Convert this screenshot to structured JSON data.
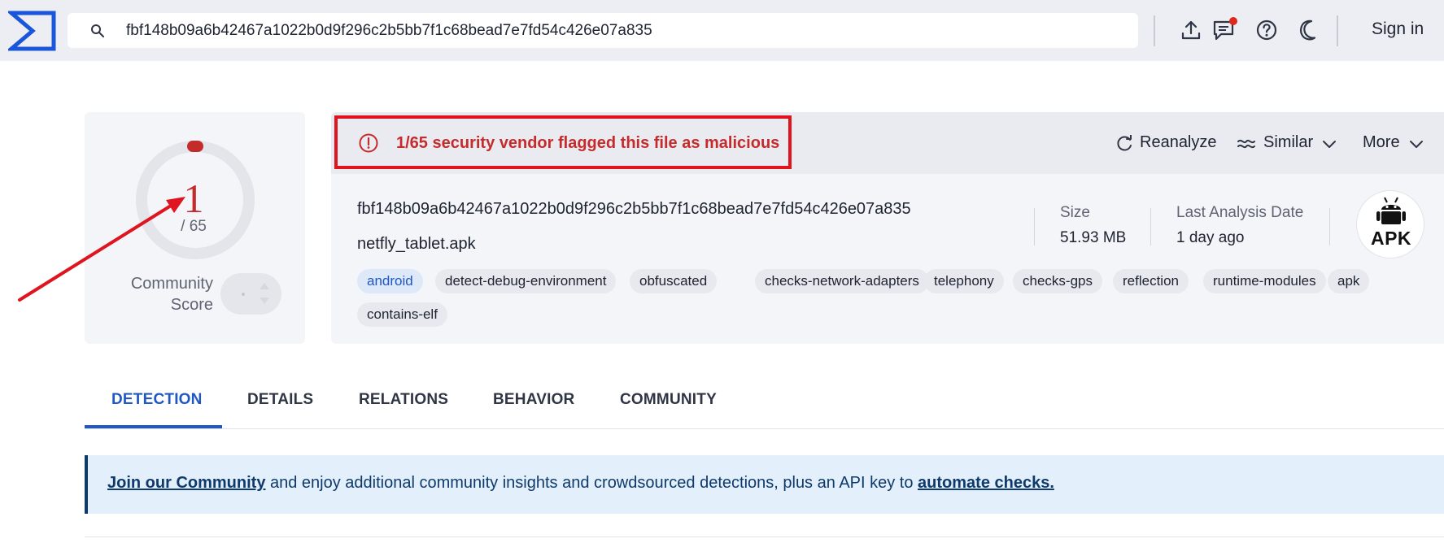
{
  "header": {
    "search_value": "fbf148b09a6b42467a1022b0d9f296c2b5bb7f1c68bead7e7fd54c426e07a835",
    "sign_in_label": "Sign in"
  },
  "score": {
    "detections": "1",
    "total": "/ 65",
    "community_label_line1": "Community",
    "community_label_line2": "Score"
  },
  "alert": {
    "text": "1/65 security vendor flagged this file as malicious",
    "color": "#c62b2b"
  },
  "actions": {
    "reanalyze": "Reanalyze",
    "similar": "Similar",
    "more": "More"
  },
  "file": {
    "hash": "fbf148b09a6b42467a1022b0d9f296c2b5bb7f1c68bead7e7fd54c426e07a835",
    "name": "netfly_tablet.apk",
    "size_label": "Size",
    "size_value": "51.93 MB",
    "date_label": "Last Analysis Date",
    "date_value": "1 day ago",
    "type_badge": "APK",
    "tags": [
      "android",
      "detect-debug-environment",
      "obfuscated",
      "checks-network-adapters",
      "telephony",
      "checks-gps",
      "reflection",
      "runtime-modules",
      "apk",
      "contains-elf"
    ]
  },
  "tabs": [
    "DETECTION",
    "DETAILS",
    "RELATIONS",
    "BEHAVIOR",
    "COMMUNITY"
  ],
  "banner": {
    "link1": "Join our Community",
    "middle": " and enjoy additional community insights and crowdsourced detections, plus an API key to ",
    "link2": "automate checks."
  },
  "colors": {
    "accent": "#1f57c3",
    "malicious": "#c62b2b",
    "annotation": "#e0141e"
  }
}
